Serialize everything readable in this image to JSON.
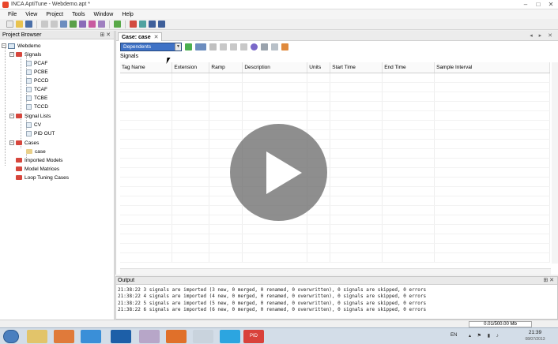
{
  "window": {
    "title": "INCA AptiTune - Webdemo.apt *",
    "minimize": "–",
    "maximize": "□",
    "close": "✕"
  },
  "menu": [
    "File",
    "View",
    "Project",
    "Tools",
    "Window",
    "Help"
  ],
  "project_browser": {
    "title": "Project Browser",
    "pins": "⊞ ✕",
    "root": "Webdemo",
    "signals_folder": "Signals",
    "signals": [
      "PCAF",
      "PCBE",
      "PCCD",
      "TCAF",
      "TCBE",
      "TCCD"
    ],
    "signal_lists_folder": "Signal Lists",
    "signal_lists": [
      "CV",
      "PID OUT"
    ],
    "cases_folder": "Cases",
    "cases": [
      "case"
    ],
    "imported_models": "Imported Models",
    "model_matrices": "Model Matrices",
    "loop_tuning_cases": "Loop Tuning Cases"
  },
  "editor": {
    "tab_label": "Case: case",
    "tab_close": "✕",
    "tab_controls": "◂ ▸ ✕",
    "dropdown_value": "Dependents",
    "section_label": "Signals",
    "columns": [
      "Tag Name",
      "Extension",
      "Ramp",
      "Description",
      "Units",
      "Start Time",
      "End Time",
      "Sample Interval"
    ]
  },
  "output": {
    "title": "Output",
    "pins": "⊞ ✕",
    "lines": [
      "21:38:22 3 signals are imported (3 new, 0 merged, 0 renamed, 0 overwritten), 0 signals are skipped, 0 errors",
      "21:38:22 4 signals are imported (4 new, 0 merged, 0 renamed, 0 overwritten), 0 signals are skipped, 0 errors",
      "21:38:22 5 signals are imported (5 new, 0 merged, 0 renamed, 0 overwritten), 0 signals are skipped, 0 errors",
      "21:38:22 6 signals are imported (6 new, 0 merged, 0 renamed, 0 overwritten), 0 signals are skipped, 0 errors"
    ]
  },
  "status": {
    "memory": "0.01/500.00 Mb"
  },
  "taskbar": {
    "pid_label": "PID",
    "language": "EN",
    "time": "21:39",
    "date": "08/07/2013"
  },
  "colors": {
    "accent": "#3f72c6",
    "folder": "#d6463c",
    "taskbar": "#d3dde8"
  }
}
